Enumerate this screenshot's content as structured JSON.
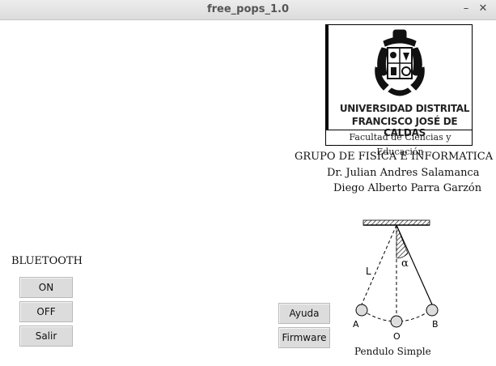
{
  "window": {
    "title": "free_pops_1.0",
    "minimize": "–",
    "close": "✕"
  },
  "logo": {
    "line1": "UNIVERSIDAD DISTRITAL",
    "line2": "FRANCISCO JOSÉ DE CALDAS",
    "faculty": "Facultad de Ciencias y Educación"
  },
  "credits": {
    "group": "GRUPO DE FISICA E INFORMATICA",
    "author1": "Dr. Julian Andres Salamanca",
    "author2": "Diego Alberto Parra Garzón"
  },
  "bluetooth": {
    "label": "BLUETOOTH",
    "on": "ON",
    "off": "OFF",
    "exit": "Salir"
  },
  "actions": {
    "help": "Ayuda",
    "firmware": "Firmware"
  },
  "pendulum": {
    "caption": "Pendulo Simple",
    "length_label": "L",
    "angle_label": "α",
    "point_a": "A",
    "point_o": "O",
    "point_b": "B"
  }
}
